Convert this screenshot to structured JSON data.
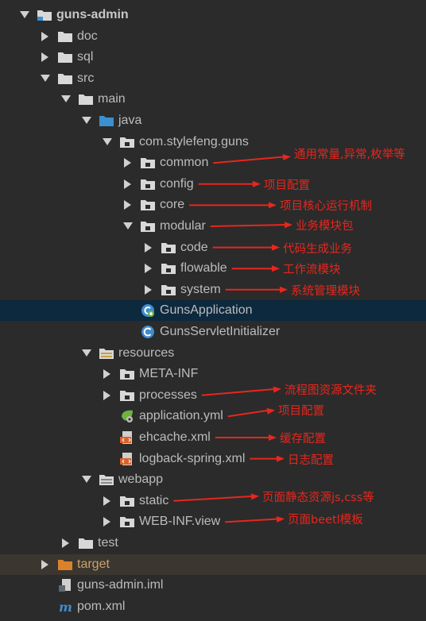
{
  "tree": [
    {
      "id": "guns-admin",
      "label": "guns-admin",
      "depth": 0,
      "arrow": "down",
      "icon": "module-folder-icon",
      "bold": true
    },
    {
      "id": "doc",
      "label": "doc",
      "depth": 1,
      "arrow": "right",
      "icon": "folder-icon"
    },
    {
      "id": "sql",
      "label": "sql",
      "depth": 1,
      "arrow": "right",
      "icon": "folder-icon"
    },
    {
      "id": "src",
      "label": "src",
      "depth": 1,
      "arrow": "down",
      "icon": "folder-icon"
    },
    {
      "id": "main",
      "label": "main",
      "depth": 2,
      "arrow": "down",
      "icon": "folder-icon"
    },
    {
      "id": "java",
      "label": "java",
      "depth": 3,
      "arrow": "down",
      "icon": "source-root-folder-icon"
    },
    {
      "id": "com-stylefeng-guns",
      "label": "com.stylefeng.guns",
      "depth": 4,
      "arrow": "down",
      "icon": "package-icon"
    },
    {
      "id": "common",
      "label": "common",
      "depth": 5,
      "arrow": "right",
      "icon": "package-icon"
    },
    {
      "id": "config",
      "label": "config",
      "depth": 5,
      "arrow": "right",
      "icon": "package-icon"
    },
    {
      "id": "core",
      "label": "core",
      "depth": 5,
      "arrow": "right",
      "icon": "package-icon"
    },
    {
      "id": "modular",
      "label": "modular",
      "depth": 5,
      "arrow": "down",
      "icon": "package-icon"
    },
    {
      "id": "code",
      "label": "code",
      "depth": 6,
      "arrow": "right",
      "icon": "package-icon"
    },
    {
      "id": "flowable",
      "label": "flowable",
      "depth": 6,
      "arrow": "right",
      "icon": "package-icon"
    },
    {
      "id": "system",
      "label": "system",
      "depth": 6,
      "arrow": "right",
      "icon": "package-icon"
    },
    {
      "id": "guns-application",
      "label": "GunsApplication",
      "depth": 5,
      "arrow": "none",
      "icon": "spring-boot-class-icon",
      "selected": true
    },
    {
      "id": "guns-servlet-initializer",
      "label": "GunsServletInitializer",
      "depth": 5,
      "arrow": "none",
      "icon": "class-icon"
    },
    {
      "id": "resources",
      "label": "resources",
      "depth": 3,
      "arrow": "down",
      "icon": "resources-folder-icon"
    },
    {
      "id": "meta-inf",
      "label": "META-INF",
      "depth": 4,
      "arrow": "right",
      "icon": "package-icon"
    },
    {
      "id": "processes",
      "label": "processes",
      "depth": 4,
      "arrow": "right",
      "icon": "package-icon"
    },
    {
      "id": "application-yml",
      "label": "application.yml",
      "depth": 4,
      "arrow": "none",
      "icon": "spring-yml-icon"
    },
    {
      "id": "ehcache-xml",
      "label": "ehcache.xml",
      "depth": 4,
      "arrow": "none",
      "icon": "xml-file-icon"
    },
    {
      "id": "logback-spring-xml",
      "label": "logback-spring.xml",
      "depth": 4,
      "arrow": "none",
      "icon": "xml-file-icon"
    },
    {
      "id": "webapp",
      "label": "webapp",
      "depth": 3,
      "arrow": "down",
      "icon": "web-folder-icon"
    },
    {
      "id": "static",
      "label": "static",
      "depth": 4,
      "arrow": "right",
      "icon": "package-icon"
    },
    {
      "id": "web-inf-view",
      "label": "WEB-INF.view",
      "depth": 4,
      "arrow": "right",
      "icon": "package-icon"
    },
    {
      "id": "test",
      "label": "test",
      "depth": 2,
      "arrow": "right",
      "icon": "folder-icon"
    },
    {
      "id": "target",
      "label": "target",
      "depth": 1,
      "arrow": "right",
      "icon": "excluded-folder-icon",
      "excluded": true
    },
    {
      "id": "guns-admin-iml",
      "label": "guns-admin.iml",
      "depth": 1,
      "arrow": "none",
      "icon": "iml-file-icon"
    },
    {
      "id": "pom-xml",
      "label": "pom.xml",
      "depth": 1,
      "arrow": "none",
      "icon": "maven-pom-icon"
    }
  ],
  "annotations": [
    {
      "target": "common",
      "text": "通用常量,异常,枚举等"
    },
    {
      "target": "config",
      "text": "项目配置"
    },
    {
      "target": "core",
      "text": "项目核心运行机制"
    },
    {
      "target": "modular",
      "text": "业务模块包"
    },
    {
      "target": "code",
      "text": "代码生成业务"
    },
    {
      "target": "flowable",
      "text": "工作流模块"
    },
    {
      "target": "system",
      "text": "系统管理模块"
    },
    {
      "target": "processes",
      "text": "流程图资源文件夹"
    },
    {
      "target": "application-yml",
      "text": "项目配置"
    },
    {
      "target": "ehcache-xml",
      "text": "缓存配置"
    },
    {
      "target": "logback-spring-xml",
      "text": "日志配置"
    },
    {
      "target": "static",
      "text": "页面静态资源js,css等"
    },
    {
      "target": "web-inf-view",
      "text": "页面beetl模板"
    }
  ],
  "colors": {
    "background": "#2b2b2b",
    "text": "#bcbcbc",
    "selection": "#0d293e",
    "excluded_row": "#3c3630",
    "folder": "#d8d8d8",
    "source_root": "#3c8fd0",
    "excluded_folder": "#d9822b",
    "annotation": "#e8261d"
  }
}
